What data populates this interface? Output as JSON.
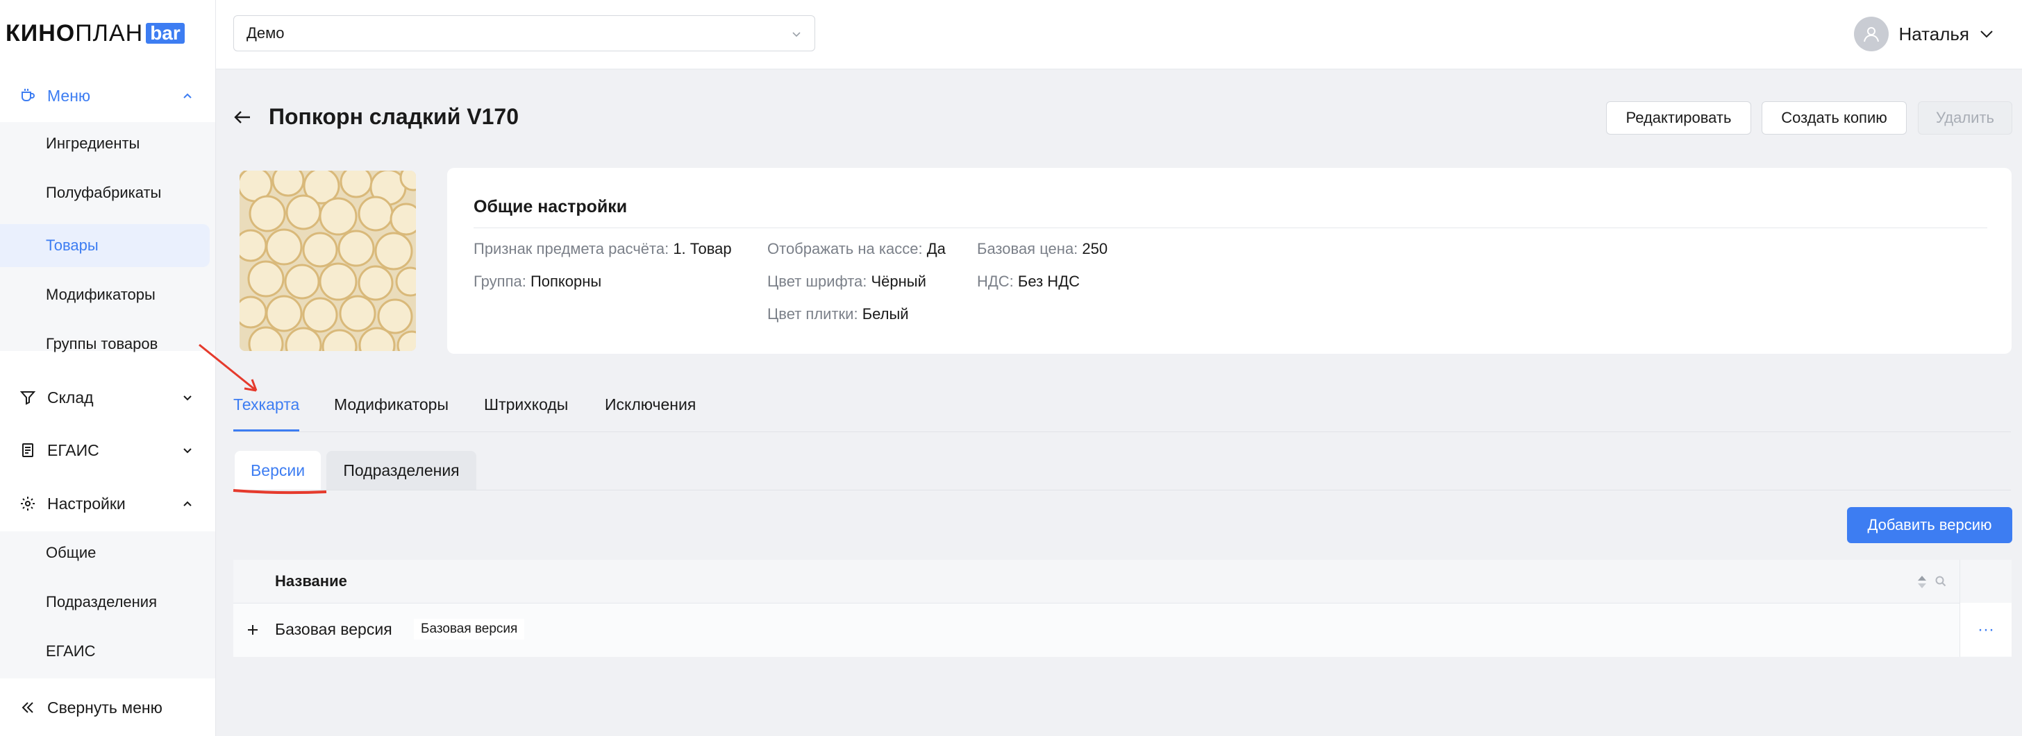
{
  "brand": {
    "logo_main": "КИНОПЛАН",
    "logo_bold": "КИНО",
    "logo_thin": "ПЛАН",
    "logo_badge": "bar",
    "accent": "#3d7df2"
  },
  "sidebar": {
    "groups": [
      {
        "label": "Меню",
        "icon": "cup-icon",
        "expanded": true,
        "active": true
      },
      {
        "label": "Склад",
        "icon": "funnel-icon",
        "expanded": false
      },
      {
        "label": "ЕГАИС",
        "icon": "document-icon",
        "expanded": false
      },
      {
        "label": "Настройки",
        "icon": "gear-icon",
        "expanded": true
      }
    ],
    "menu_items": [
      "Ингредиенты",
      "Полуфабрикаты",
      "Товары",
      "Модификаторы",
      "Группы товаров"
    ],
    "settings_items": [
      "Общие",
      "Подразделения",
      "ЕГАИС"
    ],
    "selected_item": "Товары",
    "collapse_label": "Свернуть меню"
  },
  "topbar": {
    "select_value": "Демо",
    "user_name": "Наталья"
  },
  "product": {
    "title": "Попкорн сладкий V170",
    "buttons": {
      "edit": "Редактировать",
      "copy": "Создать копию",
      "delete": "Удалить"
    }
  },
  "settings_card": {
    "title": "Общие настройки",
    "fields": {
      "payment_sign": {
        "k": "Признак предмета расчёта:",
        "v": "1. Товар"
      },
      "group": {
        "k": "Группа:",
        "v": "Попкорны"
      },
      "show_on_cashier": {
        "k": "Отображать на кассе:",
        "v": "Да"
      },
      "font_color": {
        "k": "Цвет шрифта:",
        "v": "Чёрный"
      },
      "tile_color": {
        "k": "Цвет плитки:",
        "v": "Белый"
      },
      "base_price": {
        "k": "Базовая цена:",
        "v": "250"
      },
      "vat": {
        "k": "НДС:",
        "v": "Без НДС"
      }
    }
  },
  "tabs": [
    "Техкарта",
    "Модификаторы",
    "Штрихкоды",
    "Исключения"
  ],
  "subtabs": [
    "Версии",
    "Подразделения"
  ],
  "add_version_label": "Добавить версию",
  "table": {
    "header": "Название",
    "rows": [
      {
        "name": "Базовая версия",
        "tag": "Базовая версия"
      }
    ],
    "row_actions": "···"
  }
}
